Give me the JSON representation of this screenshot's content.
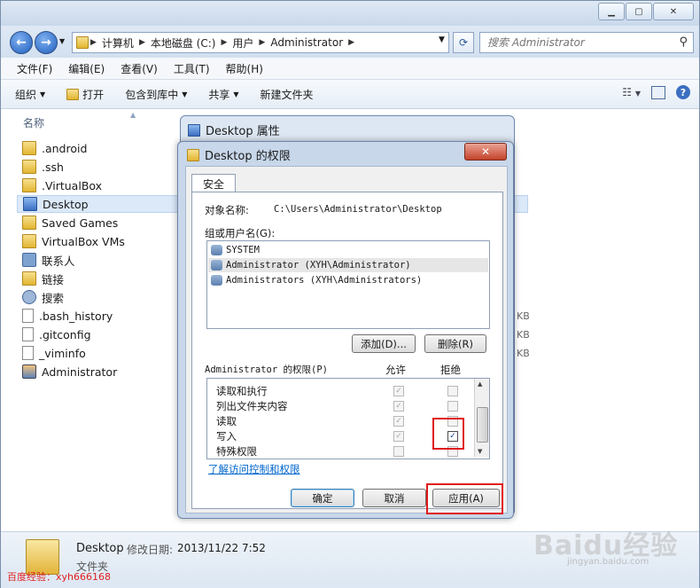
{
  "window": {
    "caption_buttons": [
      "▁",
      "▢",
      "✕"
    ],
    "breadcrumb": [
      "计算机",
      "本地磁盘 (C:)",
      "用户",
      "Administrator"
    ],
    "search_placeholder": "搜索 Administrator"
  },
  "menubar": [
    "文件(F)",
    "编辑(E)",
    "查看(V)",
    "工具(T)",
    "帮助(H)"
  ],
  "toolbar": {
    "organize": "组织",
    "open": "打开",
    "include_in_library": "包含到库中",
    "share": "共享",
    "new_folder": "新建文件夹"
  },
  "filelist": {
    "column_name": "名称",
    "items": [
      {
        "name": ".android",
        "icon": "folder-icon"
      },
      {
        "name": ".ssh",
        "icon": "folder-icon"
      },
      {
        "name": ".VirtualBox",
        "icon": "folder-icon"
      },
      {
        "name": "Desktop",
        "icon": "folder-icon",
        "selected": true
      },
      {
        "name": "Saved Games",
        "icon": "folder-icon"
      },
      {
        "name": "VirtualBox VMs",
        "icon": "folder-icon"
      },
      {
        "name": "联系人",
        "icon": "contact-icon"
      },
      {
        "name": "链接",
        "icon": "folder-icon"
      },
      {
        "name": "搜索",
        "icon": "search-folder-icon"
      },
      {
        "name": ".bash_history",
        "icon": "file-icon"
      },
      {
        "name": ".gitconfig",
        "icon": "file-icon"
      },
      {
        "name": "_viminfo",
        "icon": "file-icon"
      },
      {
        "name": "Administrator",
        "icon": "user-icon"
      }
    ],
    "size_unit": "KB"
  },
  "details": {
    "name": "Desktop",
    "modified_label": "修改日期:",
    "modified_value": "2013/11/22 7:52",
    "type": "文件夹"
  },
  "back_dialog": {
    "title": "Desktop 属性"
  },
  "dialog": {
    "title": "Desktop 的权限",
    "close": "✕",
    "tab": "安全",
    "object_label": "对象名称:",
    "object_value": "C:\\Users\\Administrator\\Desktop",
    "group_label": "组或用户名(G):",
    "users": [
      {
        "name": "SYSTEM"
      },
      {
        "name": "Administrator (XYH\\Administrator)",
        "selected": true
      },
      {
        "name": "Administrators (XYH\\Administrators)"
      }
    ],
    "add_button": "添加(D)...",
    "remove_button": "删除(R)",
    "perm_label": "Administrator 的权限(P)",
    "allow_header": "允许",
    "deny_header": "拒绝",
    "permissions": [
      {
        "name": "读取和执行",
        "allow": true,
        "deny": false,
        "deny_active": false
      },
      {
        "name": "列出文件夹内容",
        "allow": true,
        "deny": false,
        "deny_active": false
      },
      {
        "name": "读取",
        "allow": true,
        "deny": false,
        "deny_active": false
      },
      {
        "name": "写入",
        "allow": true,
        "deny": true,
        "deny_active": true
      },
      {
        "name": "特殊权限",
        "allow": false,
        "deny": false,
        "deny_active": false
      }
    ],
    "learn_link": "了解访问控制和权限",
    "ok": "确定",
    "cancel": "取消",
    "apply": "应用(A)"
  },
  "watermark": "百度经验：xyh666168",
  "baidu_logo": "Baidu经验",
  "baidu_url": "jingyan.baidu.com",
  "colors": {
    "highlight": "#e01818",
    "selection": "#dbe9f9",
    "link": "#0066cc"
  }
}
